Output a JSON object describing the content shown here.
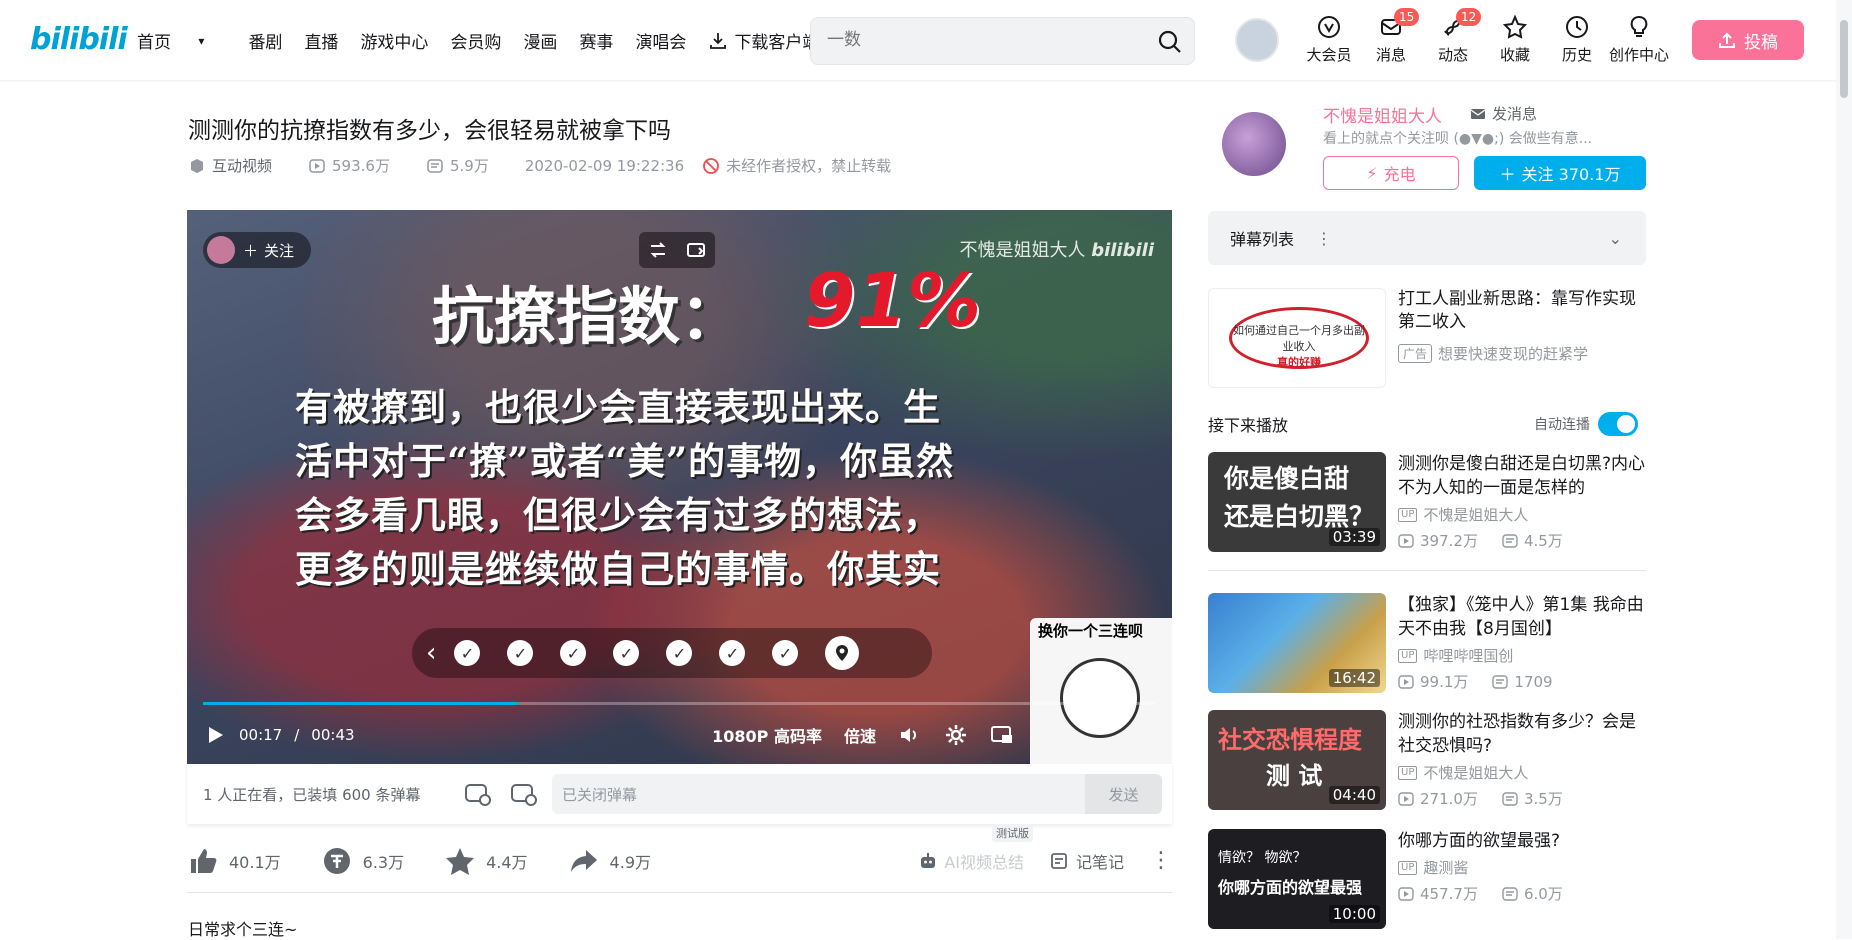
{
  "header": {
    "logo": "bilibili",
    "nav": [
      "首页",
      "番剧",
      "直播",
      "游戏中心",
      "会员购",
      "漫画",
      "赛事",
      "演唱会",
      "下载客户端"
    ],
    "search_placeholder": "一数",
    "icons": [
      {
        "label": "大会员",
        "icon": "vip-icon",
        "badge": ""
      },
      {
        "label": "消息",
        "icon": "message-icon",
        "badge": "15"
      },
      {
        "label": "动态",
        "icon": "dynamic-icon",
        "badge": "12"
      },
      {
        "label": "收藏",
        "icon": "star-icon",
        "badge": ""
      },
      {
        "label": "历史",
        "icon": "clock-icon",
        "badge": ""
      },
      {
        "label": "创作中心",
        "icon": "bulb-icon",
        "badge": ""
      }
    ],
    "upload_label": "投稿"
  },
  "video": {
    "title": "测测你的抗撩指数有多少，会很轻易就被拿下吗",
    "type": "互动视频",
    "views": "593.6万",
    "danmaku_count": "5.9万",
    "date": "2020-02-09 19:22:36",
    "copyright": "未经作者授权，禁止转载"
  },
  "player": {
    "follow_label": "关注",
    "watermark": "不愧是姐姐大人",
    "overlay_title": "抗撩指数：",
    "overlay_percent": "91%",
    "overlay_text": "有被撩到，也很少会直接表现出来。生活中对于“撩”或者“美”的事物，你虽然会多看几眼，但很少会有过多的想法，更多的则是继续做自己的事情。你其实很清楚自己想",
    "thumb_caption": "换你一个三连呗",
    "current_time": "00:17",
    "time_sep": "/",
    "total_time": "00:43",
    "progress": 0.33,
    "quality": "1080P 高码率",
    "speed": "倍速"
  },
  "danmaku_bar": {
    "info": "1 人正在看，已装填 600 条弹幕",
    "input_placeholder": "已关闭弹幕",
    "send": "发送"
  },
  "actions": {
    "like": "40.1万",
    "coin": "6.3万",
    "fav": "4.4万",
    "share": "4.9万",
    "beta_tag": "测试版",
    "ai_summary": "AI视频总结",
    "notes": "记笔记"
  },
  "description": "日常求个三连~",
  "uploader": {
    "name": "不愧是姐姐大人",
    "msg": "发消息",
    "sign": "看上的就点个关注呗 (●▼●;) 会做些有意...",
    "charge": "充电",
    "follow": "关注 370.1万"
  },
  "danmaku_list": {
    "label": "弹幕列表"
  },
  "ad": {
    "thumb_text": "如何通过自己一个月多出副业收入",
    "thumb_text2": "真的好赚",
    "title": "打工人副业新思路：靠写作实现第二收入",
    "tag": "广告",
    "sub": "想要快速变现的赶紧学"
  },
  "next": {
    "label": "接下来播放",
    "autoplay": "自动连播"
  },
  "recommendations": [
    {
      "title": "测测你是傻白甜还是白切黑?内心不为人知的一面是怎样的",
      "up": "不愧是姐姐大人",
      "views": "397.2万",
      "dm": "4.5万",
      "duration": "03:39",
      "thumb_line1": "你是傻白甜",
      "thumb_line2": "还是白切黑？"
    },
    {
      "title": "【独家】《笼中人》第1集 我命由天不由我【8月国创】",
      "up": "哔哩哔哩国创",
      "views": "99.1万",
      "dm": "1709",
      "duration": "16:42"
    },
    {
      "title": "测测你的社恐指数有多少？会是社交恐惧吗?",
      "up": "不愧是姐姐大人",
      "views": "271.0万",
      "dm": "3.5万",
      "duration": "04:40",
      "thumb_line1": "社交恐惧程度",
      "thumb_line2": "测 试"
    },
    {
      "title": "你哪方面的欲望最强?",
      "up": "趣测酱",
      "views": "457.7万",
      "dm": "6.0万",
      "duration": "10:00",
      "thumb_line1": "情欲？ 物欲？",
      "thumb_line2": "你哪方面的欲望最强"
    }
  ]
}
